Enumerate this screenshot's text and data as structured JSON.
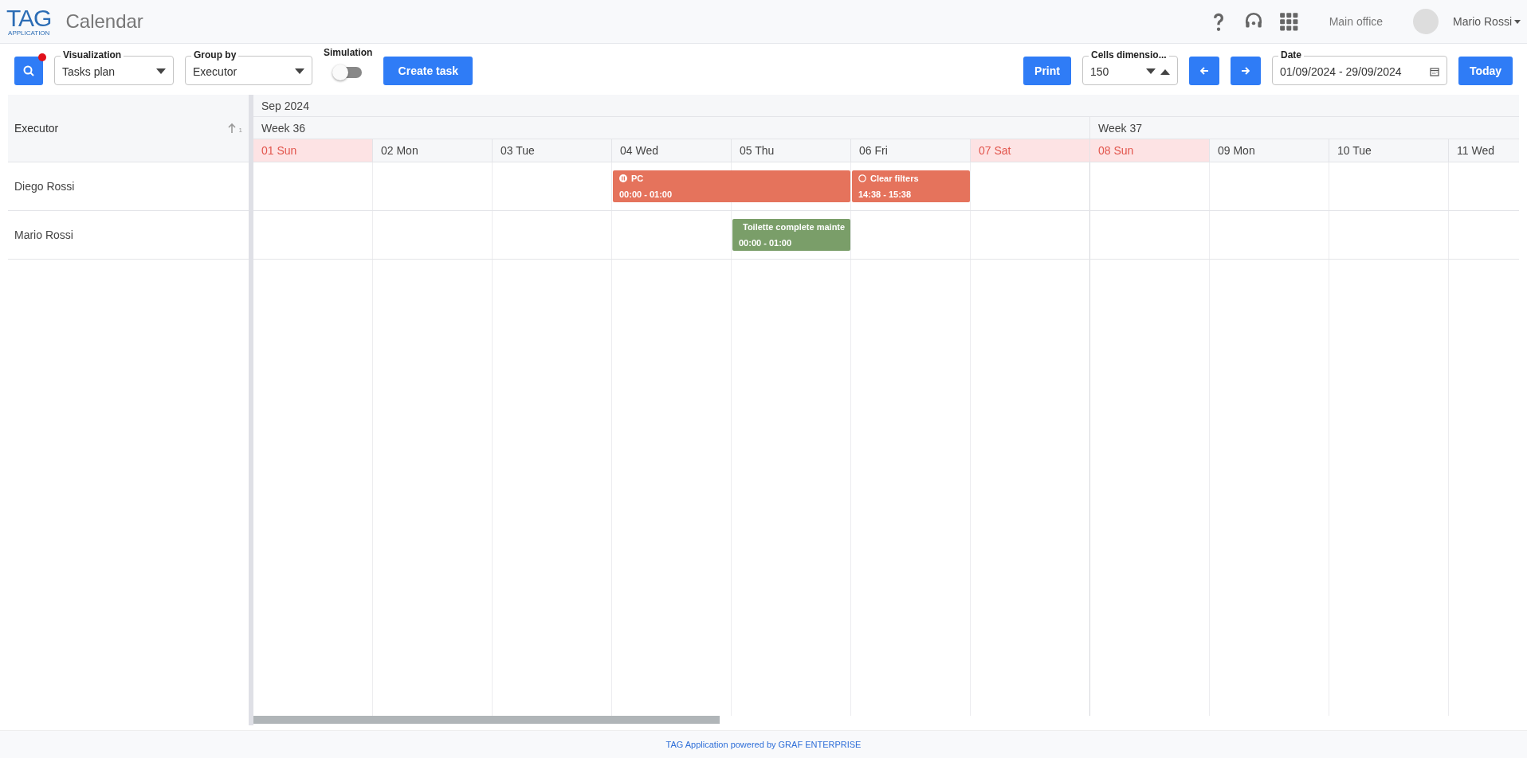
{
  "header": {
    "logo_main": "TAG",
    "logo_sub": "APPLICATION",
    "title": "Calendar",
    "office": "Main office",
    "user": "Mario Rossi"
  },
  "toolbar": {
    "filters_active": true,
    "visualization": {
      "label": "Visualization",
      "value": "Tasks plan"
    },
    "group_by": {
      "label": "Group by",
      "value": "Executor"
    },
    "simulation": {
      "label": "Simulation",
      "on": false
    },
    "create_button": "Create task",
    "print_button": "Print",
    "cells_dimension": {
      "label": "Cells dimensio...",
      "value": "150"
    },
    "date": {
      "label": "Date",
      "value": "01/09/2024 - 29/09/2024"
    },
    "today_button": "Today"
  },
  "grid": {
    "column_header": "Executor",
    "sort_badge": "1",
    "month": "Sep 2024",
    "weeks": [
      "Week 36",
      "Week 37"
    ],
    "days": [
      {
        "label": "01 Sun",
        "weekend": true,
        "new_week": true
      },
      {
        "label": "02 Mon",
        "weekend": false,
        "new_week": false
      },
      {
        "label": "03 Tue",
        "weekend": false,
        "new_week": false
      },
      {
        "label": "04 Wed",
        "weekend": false,
        "new_week": false
      },
      {
        "label": "05 Thu",
        "weekend": false,
        "new_week": false
      },
      {
        "label": "06 Fri",
        "weekend": false,
        "new_week": false
      },
      {
        "label": "07 Sat",
        "weekend": true,
        "new_week": false
      },
      {
        "label": "08 Sun",
        "weekend": true,
        "new_week": true
      },
      {
        "label": "09 Mon",
        "weekend": false,
        "new_week": false
      },
      {
        "label": "10 Tue",
        "weekend": false,
        "new_week": false
      },
      {
        "label": "11 Wed",
        "weekend": false,
        "new_week": false
      }
    ],
    "rows": [
      {
        "executor": "Diego Rossi",
        "cells": [
          {},
          {},
          {},
          {
            "event": {
              "title": "PC",
              "time": "00:00 - 01:00",
              "color": "#e5735c",
              "kind": "paused"
            }
          },
          {
            "event": {
              "continued": true
            }
          },
          {
            "event": {
              "title": "Clear filters",
              "time": "14:38 - 15:38",
              "color": "#e5735c",
              "kind": "open"
            }
          },
          {},
          {},
          {},
          {},
          {}
        ]
      },
      {
        "executor": "Mario Rossi",
        "cells": [
          {},
          {},
          {},
          {},
          {
            "event": {
              "title": "Toilette complete mainte",
              "time": "00:00 - 01:00",
              "color": "#7a9e69",
              "kind": "open"
            }
          },
          {},
          {},
          {},
          {},
          {},
          {}
        ]
      }
    ]
  },
  "footer": "TAG Application powered by GRAF ENTERPRISE"
}
